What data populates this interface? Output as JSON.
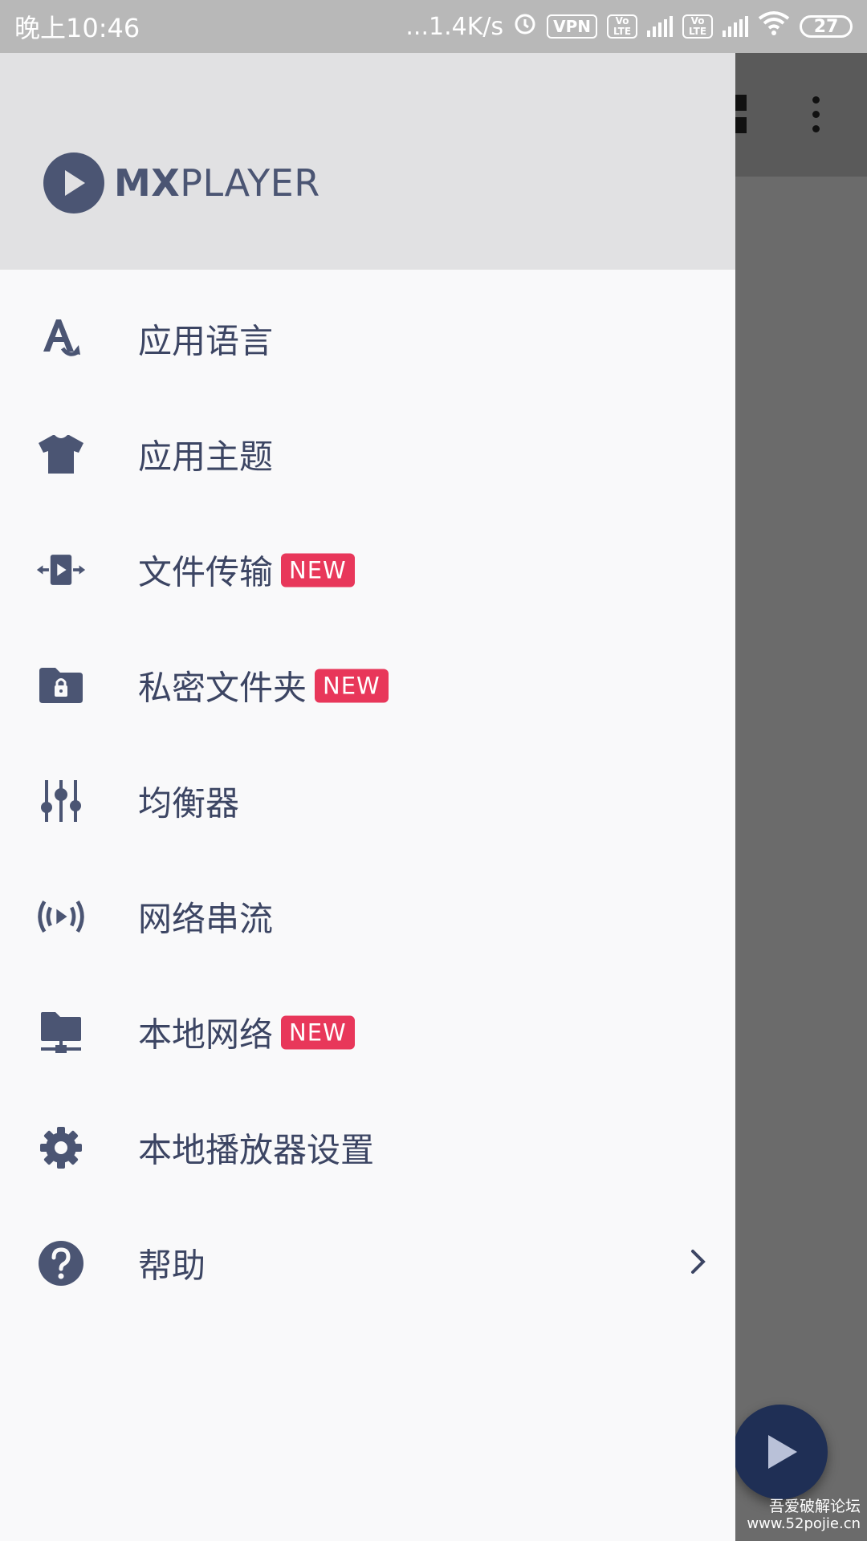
{
  "status_bar": {
    "time": "晚上10:46",
    "network_speed": "...1.4K/s",
    "vpn_label": "VPN",
    "volte_label_1": "Vo LTE",
    "volte_label_2": "Vo LTE",
    "battery_level": "27"
  },
  "drawer": {
    "logo_text_bold": "MX",
    "logo_text_light": "PLAYER",
    "menu_items": [
      {
        "label": "应用语言",
        "icon": "translate-icon",
        "badge": ""
      },
      {
        "label": "应用主题",
        "icon": "tshirt-icon",
        "badge": ""
      },
      {
        "label": "文件传输",
        "icon": "file-transfer-icon",
        "badge": "NEW"
      },
      {
        "label": "私密文件夹",
        "icon": "lock-folder-icon",
        "badge": "NEW"
      },
      {
        "label": "均衡器",
        "icon": "equalizer-icon",
        "badge": ""
      },
      {
        "label": "网络串流",
        "icon": "stream-icon",
        "badge": ""
      },
      {
        "label": "本地网络",
        "icon": "local-network-icon",
        "badge": "NEW"
      },
      {
        "label": "本地播放器设置",
        "icon": "gear-icon",
        "badge": ""
      },
      {
        "label": "帮助",
        "icon": "help-icon",
        "badge": ""
      }
    ]
  },
  "watermark": {
    "title": "吾爱破解论坛",
    "url": "www.52pojie.cn"
  },
  "colors": {
    "accent_text": "#3c4563",
    "icon": "#4b5573",
    "badge": "#e8375a",
    "fab": "#1f2f55"
  }
}
